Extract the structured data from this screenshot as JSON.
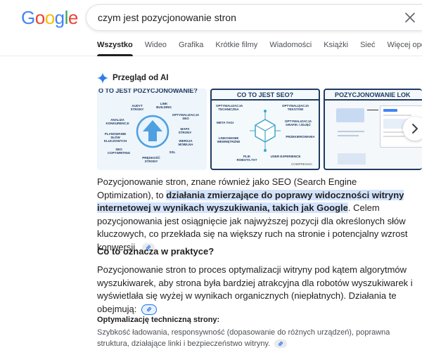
{
  "logo": {
    "letters": [
      "G",
      "o",
      "o",
      "g",
      "l",
      "e"
    ],
    "colors": [
      "#4285F4",
      "#EA4335",
      "#FBBC05",
      "#4285F4",
      "#34A853",
      "#EA4335"
    ]
  },
  "search": {
    "query": "czym jest pozycjonowanie stron",
    "clear_icon": "close-icon"
  },
  "tabs": [
    {
      "label": "Wszystko",
      "active": true
    },
    {
      "label": "Wideo"
    },
    {
      "label": "Grafika"
    },
    {
      "label": "Krótkie filmy"
    },
    {
      "label": "Wiadomości"
    },
    {
      "label": "Książki"
    },
    {
      "label": "Sieć"
    },
    {
      "label": "Więcej opcji"
    }
  ],
  "ai_overview": {
    "title": "Przegląd od AI",
    "icon": "sparkle-icon",
    "images": [
      {
        "title": "O TO JEST POZYCJONOWANIE?",
        "labels": [
          "AUDYT STRONY",
          "LINK BUILDING",
          "ANALIZA KONKURENCJI",
          "OPTYMALIZACJA SEO",
          "PLANOWANIE SŁÓW KLUCZOWYCH",
          "MAPA STRONY",
          "SEO COPYWRITING",
          "WERSJA MOBILNA",
          "SSL",
          "PRĘDKOŚĆ STRONY"
        ]
      },
      {
        "title": "CO TO JEST SEO?",
        "labels": [
          "OPTYMALIZACJA TECHNICZNA",
          "OPTYMALIZACJA TEKSTÓW",
          "META TAGI",
          "OPTYMALIZACJA GRAFIK I ZDJĘĆ",
          "LINKOWANIE WEWNĘTRZNE",
          "PRZEKIEROWANIA",
          "PLIK ROBOTS.TXT",
          "USER EXPERIENCE"
        ],
        "brand": "COMPRESSIA"
      },
      {
        "title": "POZYCJONOWANIE LOK"
      }
    ],
    "next_icon": "chevron-right-icon"
  },
  "answer": {
    "p1_before": "Pozycjonowanie stron, znane również jako SEO (Search Engine Optimization), to ",
    "p1_highlight": "działania zmierzające do poprawy widoczności witryny internetowej w wynikach wyszukiwania, takich jak Google",
    "p1_after": ". Celem pozycjonowania jest osiągnięcie jak najwyższej pozycji dla określonych słów kluczowych, co przekłada się na większy ruch na stronie i potencjalny wzrost konwersji.",
    "h2": "Co to oznacza w praktyce?",
    "p2": "Pozycjonowanie stron to proces optymalizacji witryny pod kątem algorytmów wyszukiwarek, aby strona była bardziej atrakcyjna dla robotów wyszukiwarek i wyświetlała się wyżej w wynikach organicznych (niepłatnych). Działania te obejmują:",
    "h3": "Optymalizację techniczną strony:",
    "p3": "Szybkość ładowania, responsywność (dopasowanie do różnych urządzeń), poprawna struktura, działające linki i bezpieczeństwo witryny.",
    "link_icon": "link-icon"
  },
  "colors": {
    "highlight": "#d3e3fd",
    "accent": "#1a73e8",
    "infographic_navy": "#1f3b63"
  }
}
